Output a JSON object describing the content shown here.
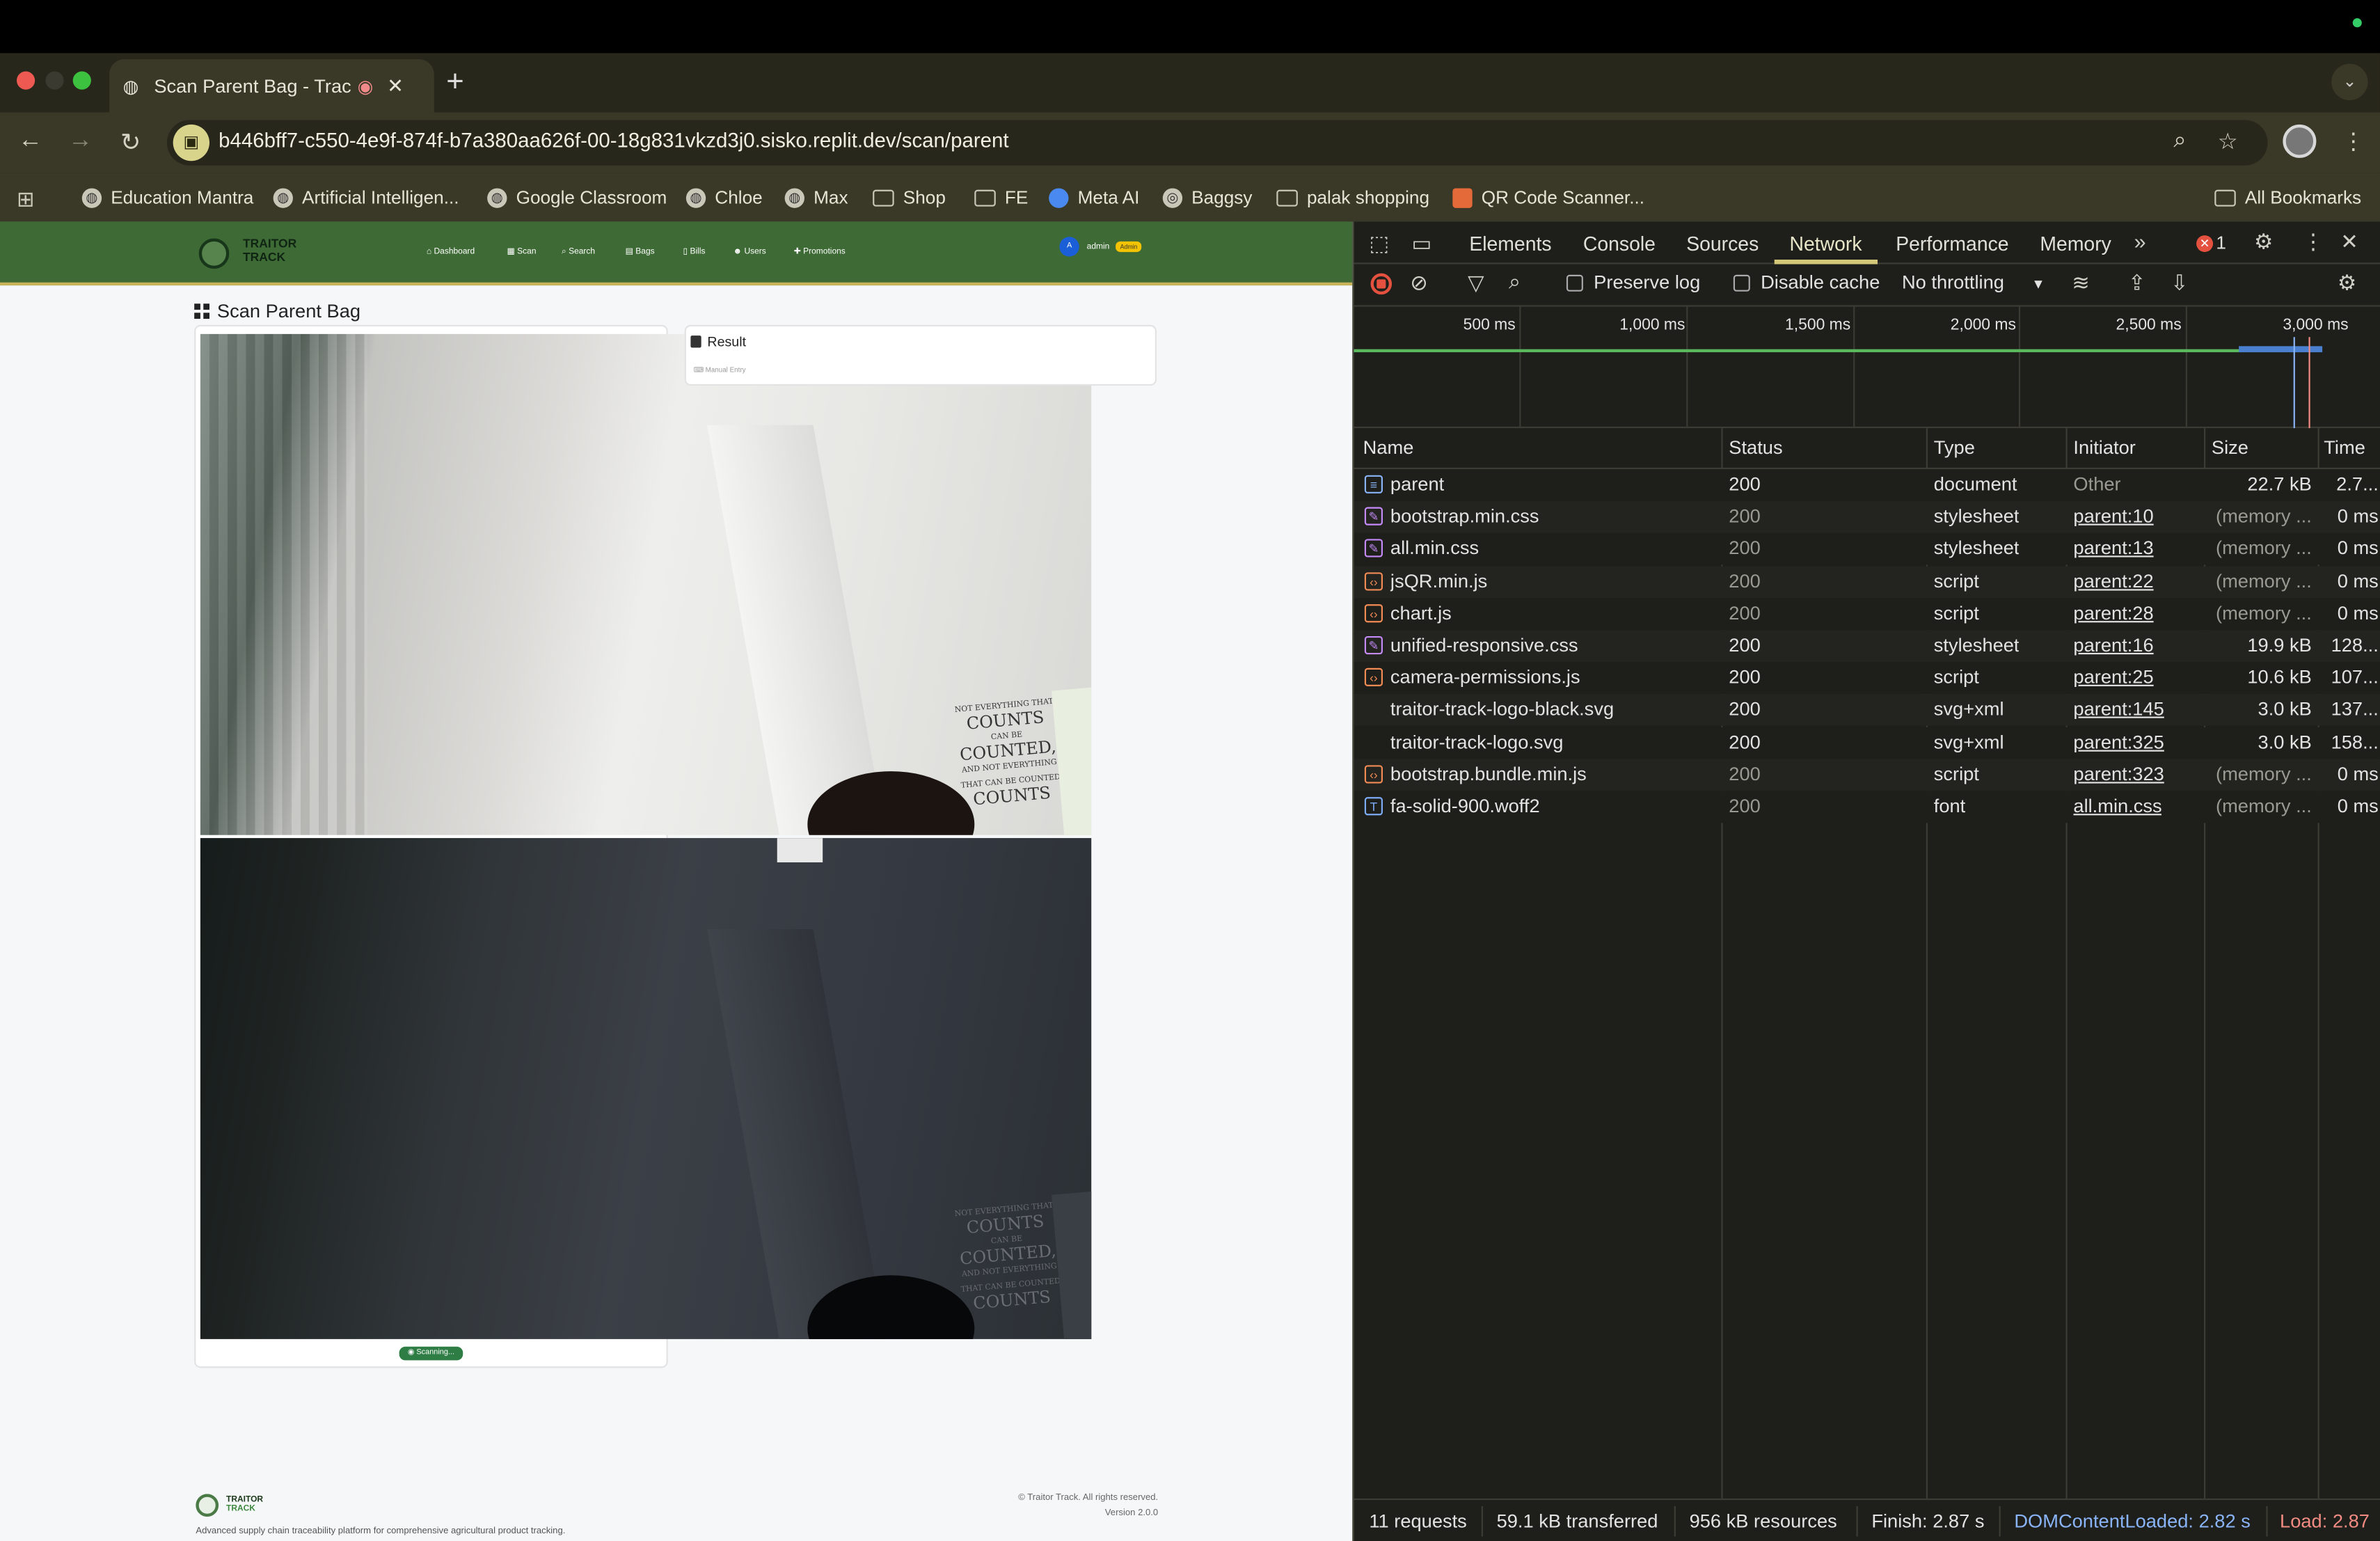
{
  "browser": {
    "tab_title": "Scan Parent Bag - TraceTr",
    "url": "b446bff7-c550-4e9f-874f-b7a380aa626f-00-18g831vkzd3j0.sisko.replit.dev/scan/parent",
    "bookmarks": [
      "Education Mantra",
      "Artificial Intelligen...",
      "Google Classroom",
      "Chloe",
      "Max",
      "Shop",
      "FE",
      "Meta AI",
      "Baggsy",
      "palak shopping",
      "QR Code Scanner..."
    ],
    "all_bookmarks": "All Bookmarks"
  },
  "app": {
    "brand_line1": "TRAITOR",
    "brand_line2": "TRACK",
    "nav": [
      "Dashboard",
      "Scan",
      "Search",
      "Bags",
      "Bills",
      "Users",
      "Promotions"
    ],
    "avatar_letter": "A",
    "user": "admin",
    "user_badge": "Admin",
    "page_title": "Scan Parent Bag",
    "result_title": "Result",
    "manual_entry": "Manual Entry",
    "scanning": "Scanning...",
    "poster_text": [
      "NOT EVERYTHING THAT",
      "COUNTS",
      "CAN BE",
      "COUNTED,",
      "AND NOT EVERYTHING",
      "THAT CAN BE COUNTED",
      "COUNTS"
    ],
    "footer_brand_line1": "TRAITOR",
    "footer_brand_line2": "TRACK",
    "footer_desc": "Advanced supply chain traceability platform for comprehensive agricultural product tracking.",
    "footer_copy": "© Traitor Track. All rights reserved.",
    "footer_version": "Version 2.0.0"
  },
  "devtools": {
    "tabs": [
      "Elements",
      "Console",
      "Sources",
      "Network",
      "Performance",
      "Memory"
    ],
    "active_tab": "Network",
    "error_count": "1",
    "preserve_log": "Preserve log",
    "disable_cache": "Disable cache",
    "throttling": "No throttling",
    "ticks": [
      "500 ms",
      "1,000 ms",
      "1,500 ms",
      "2,000 ms",
      "2,500 ms",
      "3,000 ms"
    ],
    "columns": [
      "Name",
      "Status",
      "Type",
      "Initiator",
      "Size",
      "Time"
    ],
    "rows": [
      {
        "name": "parent",
        "status": "200",
        "type": "document",
        "initiator": "Other",
        "size": "22.7 kB",
        "time": "2.7...",
        "kind": "doc",
        "dim": false
      },
      {
        "name": "bootstrap.min.css",
        "status": "200",
        "type": "stylesheet",
        "initiator": "parent:10",
        "size": "(memory ...",
        "time": "0 ms",
        "kind": "css",
        "dim": true
      },
      {
        "name": "all.min.css",
        "status": "200",
        "type": "stylesheet",
        "initiator": "parent:13",
        "size": "(memory ...",
        "time": "0 ms",
        "kind": "css",
        "dim": true
      },
      {
        "name": "jsQR.min.js",
        "status": "200",
        "type": "script",
        "initiator": "parent:22",
        "size": "(memory ...",
        "time": "0 ms",
        "kind": "js",
        "dim": true
      },
      {
        "name": "chart.js",
        "status": "200",
        "type": "script",
        "initiator": "parent:28",
        "size": "(memory ...",
        "time": "0 ms",
        "kind": "js",
        "dim": true
      },
      {
        "name": "unified-responsive.css",
        "status": "200",
        "type": "stylesheet",
        "initiator": "parent:16",
        "size": "19.9 kB",
        "time": "128...",
        "kind": "css",
        "dim": false
      },
      {
        "name": "camera-permissions.js",
        "status": "200",
        "type": "script",
        "initiator": "parent:25",
        "size": "10.6 kB",
        "time": "107...",
        "kind": "js",
        "dim": false
      },
      {
        "name": "traitor-track-logo-black.svg",
        "status": "200",
        "type": "svg+xml",
        "initiator": "parent:145",
        "size": "3.0 kB",
        "time": "137...",
        "kind": "svg",
        "dim": false
      },
      {
        "name": "traitor-track-logo.svg",
        "status": "200",
        "type": "svg+xml",
        "initiator": "parent:325",
        "size": "3.0 kB",
        "time": "158...",
        "kind": "svg",
        "dim": false
      },
      {
        "name": "bootstrap.bundle.min.js",
        "status": "200",
        "type": "script",
        "initiator": "parent:323",
        "size": "(memory ...",
        "time": "0 ms",
        "kind": "js",
        "dim": true
      },
      {
        "name": "fa-solid-900.woff2",
        "status": "200",
        "type": "font",
        "initiator": "all.min.css",
        "size": "(memory ...",
        "time": "0 ms",
        "kind": "font",
        "dim": true
      }
    ],
    "summary": {
      "requests": "11 requests",
      "transferred": "59.1 kB transferred",
      "resources": "956 kB resources",
      "finish": "Finish: 2.87 s",
      "dcl": "DOMContentLoaded: 2.82 s",
      "load": "Load: 2.87"
    }
  },
  "colors": {
    "accent": "#d3c77a",
    "app_nav": "#3e6b35",
    "dcl": "#8ab4f8",
    "load": "#f28b82"
  }
}
